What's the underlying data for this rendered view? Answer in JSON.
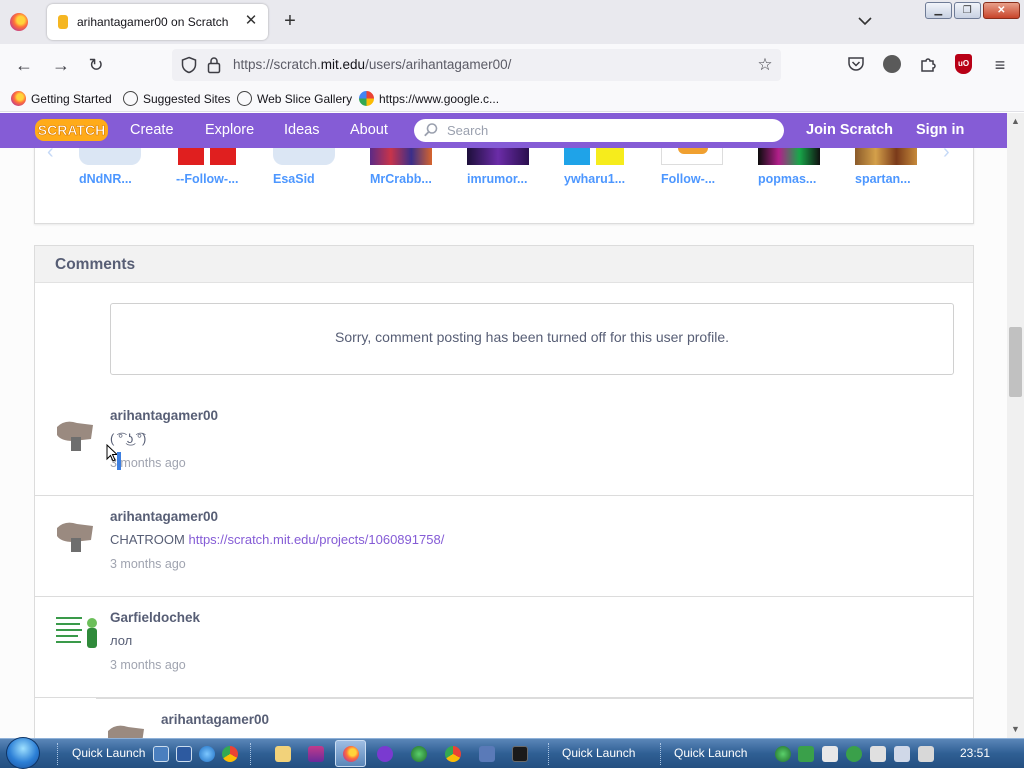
{
  "browser": {
    "tab_title": "arihantagamer00 on Scratch",
    "url_scheme": "https://scratch.",
    "url_host": "mit.edu",
    "url_path": "/users/arihantagamer00/",
    "bookmarks": [
      {
        "label": "Getting Started"
      },
      {
        "label": "Suggested Sites"
      },
      {
        "label": "Web Slice Gallery"
      },
      {
        "label": "https://www.google.c..."
      }
    ]
  },
  "scratch_nav": {
    "create": "Create",
    "explore": "Explore",
    "ideas": "Ideas",
    "about": "About",
    "search_placeholder": "Search",
    "join": "Join Scratch",
    "signin": "Sign in"
  },
  "following": {
    "users": [
      "dNdNR...",
      "--Follow-...",
      "EsaSid",
      "MrCrabb...",
      "imrumor...",
      "ywharu1...",
      "Follow-...",
      "popmas...",
      "spartan..."
    ]
  },
  "comments": {
    "header": "Comments",
    "notice": "Sorry, comment posting has been turned off for this user profile.",
    "items": [
      {
        "author": "arihantagamer00",
        "text": "( ͡° ͜ʖ ͡°)",
        "time": "3 months ago"
      },
      {
        "author": "arihantagamer00",
        "text": "CHATROOM ",
        "link": "https://scratch.mit.edu/projects/1060891758/",
        "time": "3 months ago"
      },
      {
        "author": "Garfieldochek",
        "text": "лол",
        "time": "3 months ago"
      }
    ],
    "reply_author": "arihantagamer00"
  },
  "taskbar": {
    "quick_launch_1": "Quick Launch",
    "quick_launch_2": "Quick Launch",
    "quick_launch_3": "Quick Launch",
    "clock": "23:51"
  },
  "colors": {
    "scratch_purple": "#855cd6",
    "link_blue": "#4d97ff",
    "text_gray": "#575e75"
  }
}
